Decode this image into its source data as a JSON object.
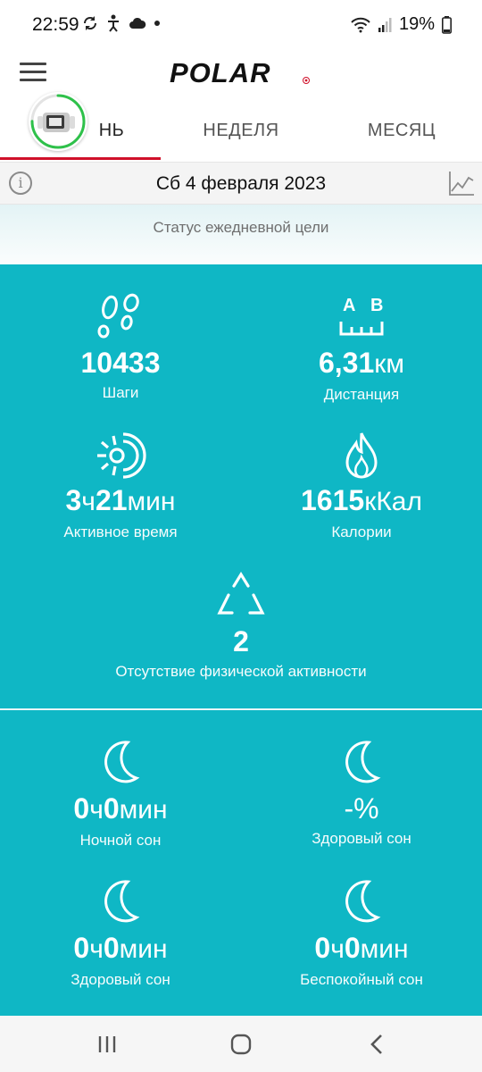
{
  "status_bar": {
    "time": "22:59",
    "battery": "19%"
  },
  "app": {
    "logo": "POLAR"
  },
  "tabs": [
    {
      "label": "ДЕНЬ",
      "visible_label": "НЬ"
    },
    {
      "label": "НЕДЕЛЯ"
    },
    {
      "label": "МЕСЯЦ"
    }
  ],
  "date": "Сб 4 февраля 2023",
  "goal_status": "Статус ежедневной цели",
  "metrics": {
    "steps": {
      "value": "10433",
      "label": "Шаги",
      "icon": "footprints-icon"
    },
    "distance": {
      "value": "6,31",
      "unit": "км",
      "label": "Дистанция",
      "icon": "distance-ab-icon",
      "icon_a": "A",
      "icon_b": "B"
    },
    "active_time": {
      "value_h": "3",
      "unit_h": "ч",
      "value_m": "21",
      "unit_m": "мин",
      "label": "Активное время",
      "icon": "active-time-icon"
    },
    "calories": {
      "value": "1615",
      "unit": "кКал",
      "label": "Калории",
      "icon": "flame-icon"
    },
    "inactivity": {
      "value": "2",
      "label": "Отсутствие физической активности",
      "icon": "inactivity-triangle-icon"
    }
  },
  "sleep": {
    "night_sleep": {
      "value_h": "0",
      "unit_h": "ч",
      "value_m": "0",
      "unit_m": "мин",
      "label": "Ночной сон"
    },
    "healthy_sleep_pct": {
      "value": "-%",
      "label": "Здоровый сон"
    },
    "healthy_sleep": {
      "value_h": "0",
      "unit_h": "ч",
      "value_m": "0",
      "unit_m": "мин",
      "label": "Здоровый сон"
    },
    "restless_sleep": {
      "value_h": "0",
      "unit_h": "ч",
      "value_m": "0",
      "unit_m": "мин",
      "label": "Беспокойный сон"
    }
  },
  "colors": {
    "accent": "#0fb7c5",
    "tab_indicator": "#d0102a",
    "logo_red": "#d0102a"
  },
  "device_progress": 0.75
}
